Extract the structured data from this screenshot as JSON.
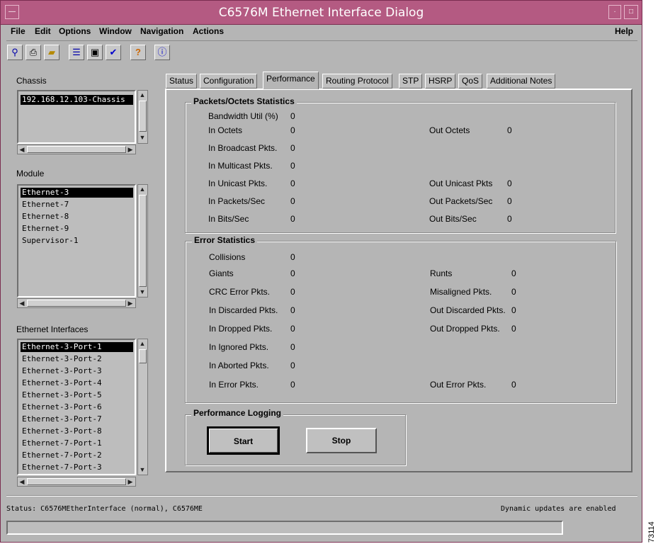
{
  "window": {
    "title": "C6576M Ethernet Interface Dialog"
  },
  "menu": {
    "file": "File",
    "edit": "Edit",
    "options": "Options",
    "window": "Window",
    "navigation": "Navigation",
    "actions": "Actions",
    "help": "Help"
  },
  "toolbar_icons": [
    "network-icon",
    "printer-icon",
    "open-folder-icon",
    "list-icon",
    "monitor-icon",
    "checkmark-icon",
    "help-icon",
    "info-icon"
  ],
  "chassis": {
    "label": "Chassis",
    "items": [
      "192.168.12.103-Chassis"
    ]
  },
  "module": {
    "label": "Module",
    "items": [
      "Ethernet-3",
      "Ethernet-7",
      "Ethernet-8",
      "Ethernet-9",
      "Supervisor-1"
    ]
  },
  "interfaces": {
    "label": "Ethernet Interfaces",
    "items": [
      "Ethernet-3-Port-1",
      "Ethernet-3-Port-2",
      "Ethernet-3-Port-3",
      "Ethernet-3-Port-4",
      "Ethernet-3-Port-5",
      "Ethernet-3-Port-6",
      "Ethernet-3-Port-7",
      "Ethernet-3-Port-8",
      "Ethernet-7-Port-1",
      "Ethernet-7-Port-2",
      "Ethernet-7-Port-3"
    ]
  },
  "tabs": [
    "Status",
    "Configuration",
    "Performance",
    "Routing Protocol",
    "STP",
    "HSRP",
    "QoS",
    "Additional Notes"
  ],
  "packets": {
    "title": "Packets/Octets Statistics",
    "bandwidth_util": {
      "label": "Bandwidth Util (%)",
      "value": "0"
    },
    "in_octets": {
      "label": "In Octets",
      "value": "0"
    },
    "out_octets": {
      "label": "Out Octets",
      "value": "0"
    },
    "in_broadcast": {
      "label": "In Broadcast Pkts.",
      "value": "0"
    },
    "in_multicast": {
      "label": "In Multicast Pkts.",
      "value": "0"
    },
    "in_unicast": {
      "label": "In Unicast Pkts.",
      "value": "0"
    },
    "out_unicast": {
      "label": "Out Unicast Pkts",
      "value": "0"
    },
    "in_packets_sec": {
      "label": "In Packets/Sec",
      "value": "0"
    },
    "out_packets_sec": {
      "label": "Out Packets/Sec",
      "value": "0"
    },
    "in_bits_sec": {
      "label": "In Bits/Sec",
      "value": "0"
    },
    "out_bits_sec": {
      "label": "Out Bits/Sec",
      "value": "0"
    }
  },
  "errors": {
    "title": "Error Statistics",
    "collisions": {
      "label": "Collisions",
      "value": "0"
    },
    "giants": {
      "label": "Giants",
      "value": "0"
    },
    "runts": {
      "label": "Runts",
      "value": "0"
    },
    "crc": {
      "label": "CRC Error Pkts.",
      "value": "0"
    },
    "misaligned": {
      "label": "Misaligned Pkts.",
      "value": "0"
    },
    "in_discarded": {
      "label": "In Discarded Pkts.",
      "value": "0"
    },
    "out_discarded": {
      "label": "Out Discarded Pkts.",
      "value": "0"
    },
    "in_dropped": {
      "label": "In Dropped Pkts.",
      "value": "0"
    },
    "out_dropped": {
      "label": "Out Dropped Pkts.",
      "value": "0"
    },
    "in_ignored": {
      "label": "In Ignored Pkts.",
      "value": "0"
    },
    "in_aborted": {
      "label": "In Aborted Pkts.",
      "value": "0"
    },
    "in_error": {
      "label": "In Error Pkts.",
      "value": "0"
    },
    "out_error": {
      "label": "Out Error Pkts.",
      "value": "0"
    }
  },
  "logging": {
    "title": "Performance Logging",
    "start": "Start",
    "stop": "Stop"
  },
  "status": {
    "left": "Status: C6576MEtherInterface (normal), C6576ME",
    "right": "Dynamic updates are enabled"
  },
  "figure_id": "73114"
}
